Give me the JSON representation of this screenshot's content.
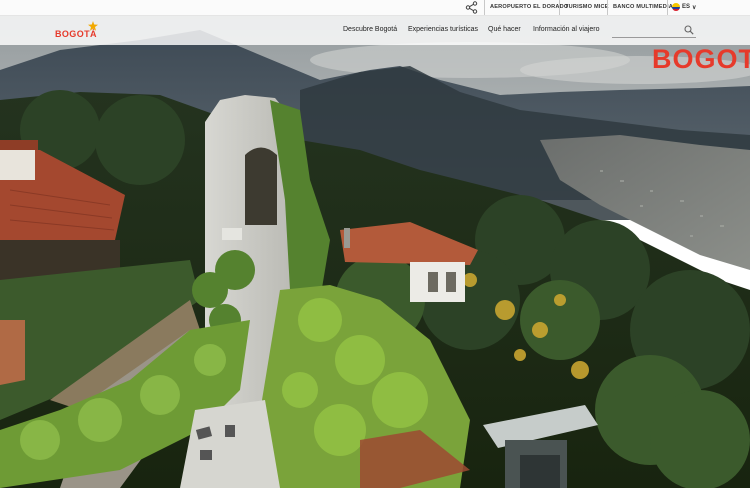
{
  "topbar": {
    "share_icon": "share-icon",
    "links": [
      "AEROPUERTO EL DORADO",
      "TURISMO MICE",
      "BANCO MULTIMEDIA"
    ],
    "language": "ES",
    "language_flag": "colombia-flag-icon"
  },
  "brand": {
    "logo_text": "BOGOTÁ",
    "logo_color": "#e63a2b",
    "watermark_text": "BOGOT"
  },
  "nav": {
    "items": [
      "Descubre Bogotá",
      "Experiencias turísticas",
      "Qué hacer",
      "Información al viajero"
    ]
  },
  "search": {
    "value": "",
    "placeholder": "",
    "icon": "search-icon"
  },
  "hero": {
    "description_icon": "hero-photo"
  }
}
